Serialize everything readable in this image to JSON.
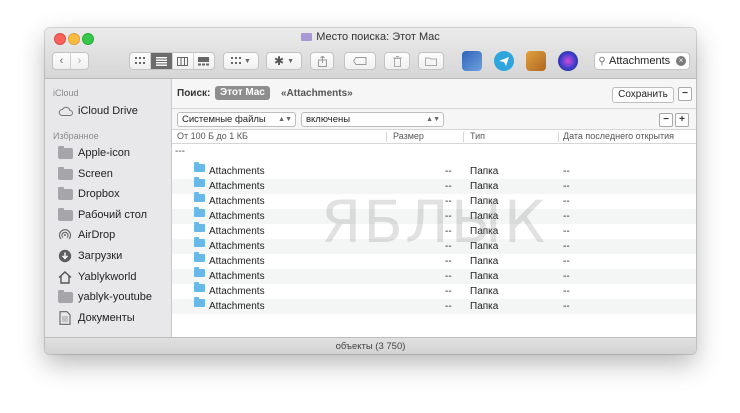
{
  "window": {
    "title": "Место поиска: Этот Mac"
  },
  "search": {
    "value": "Attachments"
  },
  "sidebar": {
    "sections": [
      {
        "header": "iCloud",
        "items": [
          {
            "label": "iCloud Drive",
            "icon": "cloud-icon"
          }
        ]
      },
      {
        "header": "Избранное",
        "items": [
          {
            "label": "Apple-icon",
            "icon": "folder-icon"
          },
          {
            "label": "Screen",
            "icon": "folder-icon"
          },
          {
            "label": "Dropbox",
            "icon": "folder-icon"
          },
          {
            "label": "Рабочий стол",
            "icon": "folder-icon"
          },
          {
            "label": "AirDrop",
            "icon": "airdrop-icon"
          },
          {
            "label": "Загрузки",
            "icon": "downloads-icon"
          },
          {
            "label": "Yablykworld",
            "icon": "home-icon"
          },
          {
            "label": "yablyk-youtube",
            "icon": "folder-icon"
          },
          {
            "label": "Документы",
            "icon": "documents-icon"
          }
        ]
      }
    ]
  },
  "scope": {
    "label": "Поиск:",
    "selected": "Этот Mac",
    "alternative": "«Attachments»",
    "save_label": "Сохранить"
  },
  "criteria": {
    "attribute": "Системные файлы",
    "value": "включены"
  },
  "columns": {
    "name": "От 100 Б до 1 КБ",
    "size": "Размер",
    "kind": "Тип",
    "last_opened": "Дата последнего открытия"
  },
  "group_label": "---",
  "rows": [
    {
      "name": "Attachments",
      "size": "--",
      "kind": "Папка",
      "date": "--"
    },
    {
      "name": "Attachments",
      "size": "--",
      "kind": "Папка",
      "date": "--"
    },
    {
      "name": "Attachments",
      "size": "--",
      "kind": "Папка",
      "date": "--"
    },
    {
      "name": "Attachments",
      "size": "--",
      "kind": "Папка",
      "date": "--"
    },
    {
      "name": "Attachments",
      "size": "--",
      "kind": "Папка",
      "date": "--"
    },
    {
      "name": "Attachments",
      "size": "--",
      "kind": "Папка",
      "date": "--"
    },
    {
      "name": "Attachments",
      "size": "--",
      "kind": "Папка",
      "date": "--"
    },
    {
      "name": "Attachments",
      "size": "--",
      "kind": "Папка",
      "date": "--"
    },
    {
      "name": "Attachments",
      "size": "--",
      "kind": "Папка",
      "date": "--"
    },
    {
      "name": "Attachments",
      "size": "--",
      "kind": "Папка",
      "date": "--"
    }
  ],
  "status": {
    "items": "объекты (3 750)"
  },
  "watermark": "ЯБЛЫК",
  "colors": {
    "traffic_red": "#fc605b",
    "traffic_yellow": "#fdbc40",
    "traffic_green": "#34c84a",
    "folder_blue": "#69b8ea"
  }
}
